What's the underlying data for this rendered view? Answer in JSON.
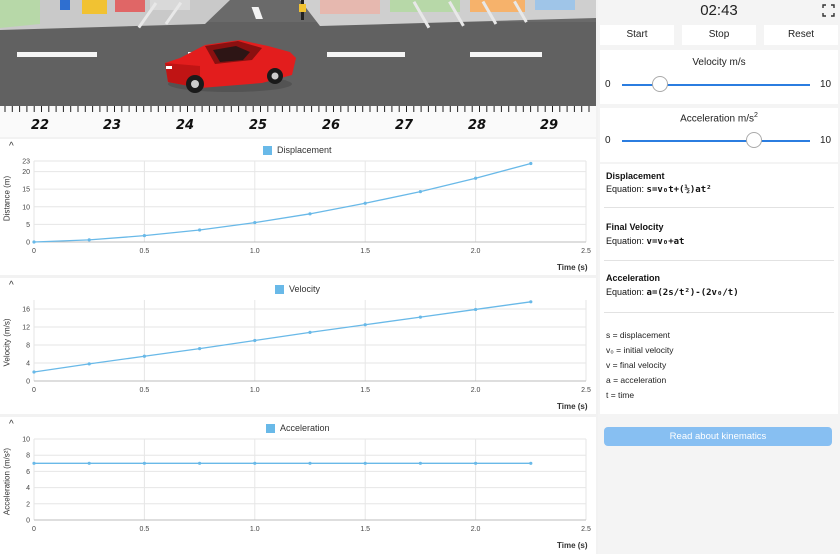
{
  "scene": {
    "ruler_labels": [
      "22",
      "23",
      "24",
      "25",
      "26",
      "27",
      "28",
      "29"
    ]
  },
  "panel": {
    "timer": "02:43",
    "buttons": {
      "start": "Start",
      "stop": "Stop",
      "reset": "Reset"
    },
    "velocity_slider": {
      "title": "Velocity m/s",
      "min": "0",
      "max": "10",
      "value_fraction": 0.2
    },
    "acceleration_slider": {
      "title_text": "Acceleration m/s",
      "title_sup": "2",
      "min": "0",
      "max": "10",
      "value_fraction": 0.7
    },
    "equations": [
      {
        "title": "Displacement",
        "prefix": "Equation: ",
        "formula": "s=v₀t+(½)at²"
      },
      {
        "title": "Final Velocity",
        "prefix": "Equation: ",
        "formula": "v=v₀+at"
      },
      {
        "title": "Acceleration",
        "prefix": "Equation: ",
        "formula": "a=(2s/t²)-(2v₀/t)"
      }
    ],
    "legend": [
      "s = displacement",
      "v₀ = initial velocity",
      "v = final velocity",
      "a = acceleration",
      "t = time"
    ],
    "read_button": "Read about kinematics"
  },
  "colors": {
    "series": "#69b9e8",
    "accent": "#2b7de0",
    "car": "#e31d1d",
    "road": "#5f5f5f"
  },
  "chart_data": [
    {
      "type": "line",
      "legend": "Displacement",
      "xlabel": "Time (s)",
      "ylabel": "Distance (m)",
      "xlim": [
        0,
        2.5
      ],
      "ylim": [
        0,
        23
      ],
      "x_ticks": [
        "0",
        "0.5",
        "1.0",
        "1.5",
        "2.0",
        "2.5"
      ],
      "y_ticks": [
        "0",
        "5",
        "10",
        "15",
        "20",
        "23"
      ],
      "y_tick_values": [
        0,
        5,
        10,
        15,
        20,
        23
      ],
      "x": [
        0,
        0.25,
        0.5,
        0.75,
        1.0,
        1.25,
        1.5,
        1.75,
        2.0,
        2.25
      ],
      "values": [
        0,
        0.6,
        1.8,
        3.4,
        5.5,
        8.0,
        11.0,
        14.3,
        18.1,
        22.3
      ]
    },
    {
      "type": "line",
      "legend": "Velocity",
      "xlabel": "Time (s)",
      "ylabel": "Velocity (m/s)",
      "xlim": [
        0,
        2.5
      ],
      "ylim": [
        0,
        18
      ],
      "x_ticks": [
        "0",
        "0.5",
        "1.0",
        "1.5",
        "2.0",
        "2.5"
      ],
      "y_ticks": [
        "0",
        "4",
        "8",
        "12",
        "16"
      ],
      "y_tick_values": [
        0,
        4,
        8,
        12,
        16
      ],
      "x": [
        0,
        0.25,
        0.5,
        0.75,
        1.0,
        1.25,
        1.5,
        1.75,
        2.0,
        2.25
      ],
      "values": [
        2.0,
        3.8,
        5.5,
        7.2,
        9.0,
        10.8,
        12.5,
        14.2,
        15.9,
        17.6
      ]
    },
    {
      "type": "line",
      "legend": "Acceleration",
      "xlabel": "Time (s)",
      "ylabel": "Acceleration (m/s²)",
      "xlim": [
        0,
        2.5
      ],
      "ylim": [
        0,
        10
      ],
      "x_ticks": [
        "0",
        "0.5",
        "1.0",
        "1.5",
        "2.0",
        "2.5"
      ],
      "y_ticks": [
        "0",
        "2",
        "4",
        "6",
        "8",
        "10"
      ],
      "y_tick_values": [
        0,
        2,
        4,
        6,
        8,
        10
      ],
      "x": [
        0,
        0.25,
        0.5,
        0.75,
        1.0,
        1.25,
        1.5,
        1.75,
        2.0,
        2.25
      ],
      "values": [
        7,
        7,
        7,
        7,
        7,
        7,
        7,
        7,
        7,
        7
      ]
    }
  ]
}
